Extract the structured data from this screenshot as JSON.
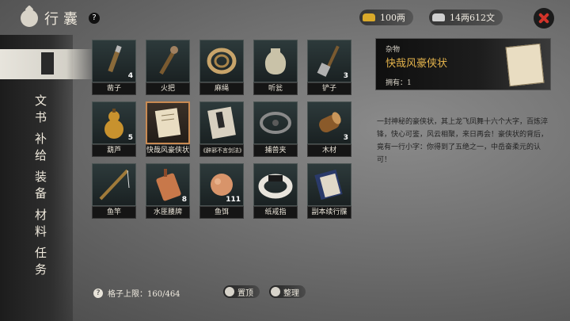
{
  "header": {
    "title": "行囊",
    "help_label": "?"
  },
  "currency": {
    "gold": "100两",
    "silver": "14两612文"
  },
  "sidebar": {
    "items": [
      {
        "label": "",
        "icon": "backpack-icon",
        "active": true
      },
      {
        "label": "文书"
      },
      {
        "label": "补给"
      },
      {
        "label": "装备"
      },
      {
        "label": "材料"
      },
      {
        "label": "任务"
      }
    ]
  },
  "items": [
    {
      "label": "凿子",
      "qty": "4"
    },
    {
      "label": "火把",
      "qty": ""
    },
    {
      "label": "麻绳",
      "qty": ""
    },
    {
      "label": "听瓮",
      "qty": ""
    },
    {
      "label": "铲子",
      "qty": "3"
    },
    {
      "label": "葫芦",
      "qty": "5"
    },
    {
      "label": "快哉风豪侠状",
      "qty": ""
    },
    {
      "label": "《辟邪不言剑法》",
      "qty": ""
    },
    {
      "label": "捕兽夹",
      "qty": ""
    },
    {
      "label": "木材",
      "qty": "3"
    },
    {
      "label": "鱼竿",
      "qty": ""
    },
    {
      "label": "水匪腰牌",
      "qty": "8"
    },
    {
      "label": "鱼饵",
      "qty": "111"
    },
    {
      "label": "纸戒指",
      "qty": ""
    },
    {
      "label": "副本续行牒",
      "qty": ""
    }
  ],
  "detail": {
    "category": "杂物",
    "name": "快哉风豪侠状",
    "owned": "拥有：1",
    "description": "一封神秘的豪侠状，其上龙飞凤舞十六个大字，百炼淬锋，快心可鉴，风云相聚，来日再会！豪侠状的背后，竟有一行小字：你得到了五绝之一，中岳奋柔元的认可！"
  },
  "footer": {
    "capacity": "格子上限：160/464",
    "pin_label": "置顶",
    "sort_label": "整理"
  },
  "colors": {
    "accent": "#e5b44c",
    "selected_border": "#c98a52",
    "close": "#d2342a"
  }
}
